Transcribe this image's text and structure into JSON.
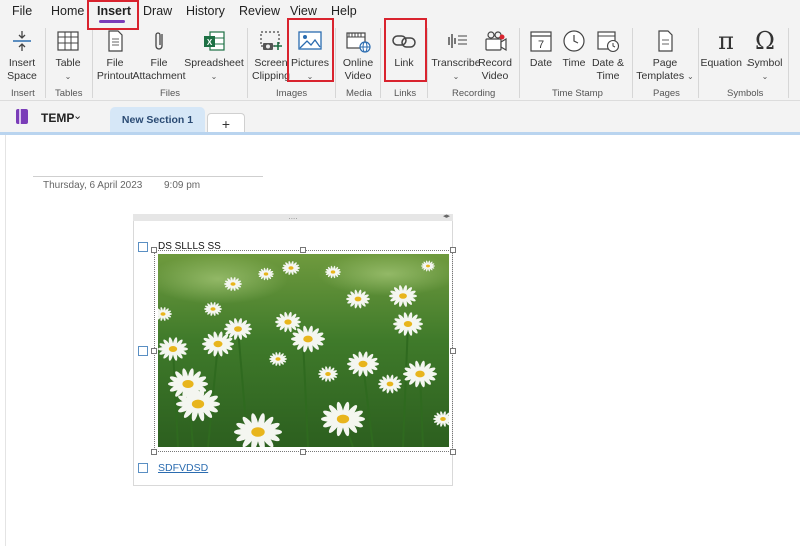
{
  "menu": [
    "File",
    "Home",
    "Insert",
    "Draw",
    "History",
    "Review",
    "View",
    "Help"
  ],
  "active_menu": "Insert",
  "accent_color": "#7a3db8",
  "highlight_color": "#d9232e",
  "ribbon": {
    "insert_space": {
      "line1": "Insert",
      "line2": "Space",
      "icon": "insert-space-icon"
    },
    "table": {
      "line1": "Table",
      "icon": "table-icon"
    },
    "file_printout": {
      "line1": "File",
      "line2": "Printout",
      "icon": "file-printout-icon"
    },
    "file_attachment": {
      "line1": "File",
      "line2": "Attachment",
      "icon": "paperclip-icon"
    },
    "spreadsheet": {
      "line1": "Spreadsheet",
      "icon": "excel-icon"
    },
    "screen_clipping": {
      "line1": "Screen",
      "line2": "Clipping",
      "icon": "screen-clipping-icon"
    },
    "pictures": {
      "line1": "Pictures",
      "icon": "picture-icon"
    },
    "online_video": {
      "line1": "Online",
      "line2": "Video",
      "icon": "online-video-icon"
    },
    "link": {
      "line1": "Link",
      "icon": "link-icon"
    },
    "transcribe": {
      "line1": "Transcribe",
      "icon": "transcribe-icon"
    },
    "record_video": {
      "line1": "Record",
      "line2": "Video",
      "icon": "video-camera-icon"
    },
    "date": {
      "line1": "Date",
      "icon": "calendar-icon",
      "day": "7"
    },
    "time": {
      "line1": "Time",
      "icon": "clock-icon"
    },
    "date_time": {
      "line1": "Date &",
      "line2": "Time",
      "icon": "calendar-clock-icon"
    },
    "page_templates": {
      "line1": "Page",
      "line2": "Templates",
      "icon": "page-template-icon"
    },
    "equation": {
      "line1": "Equation",
      "icon": "pi-icon",
      "glyph": "π"
    },
    "symbol": {
      "line1": "Symbol",
      "icon": "omega-icon",
      "glyph": "Ω"
    },
    "groups": [
      "Insert",
      "Tables",
      "Files",
      "Images",
      "Media",
      "Links",
      "Recording",
      "Time Stamp",
      "Pages",
      "Symbols"
    ]
  },
  "notebook": {
    "name": "TEMP",
    "section_tab": "New Section 1",
    "add_tab": "+"
  },
  "page": {
    "date": "Thursday, 6 April 2023",
    "time": "9:09 pm",
    "outline_handle": "....",
    "line1": "DS SLLLS SS",
    "image_alt": "field of white daisies",
    "link_text": "SDFVDSD"
  }
}
